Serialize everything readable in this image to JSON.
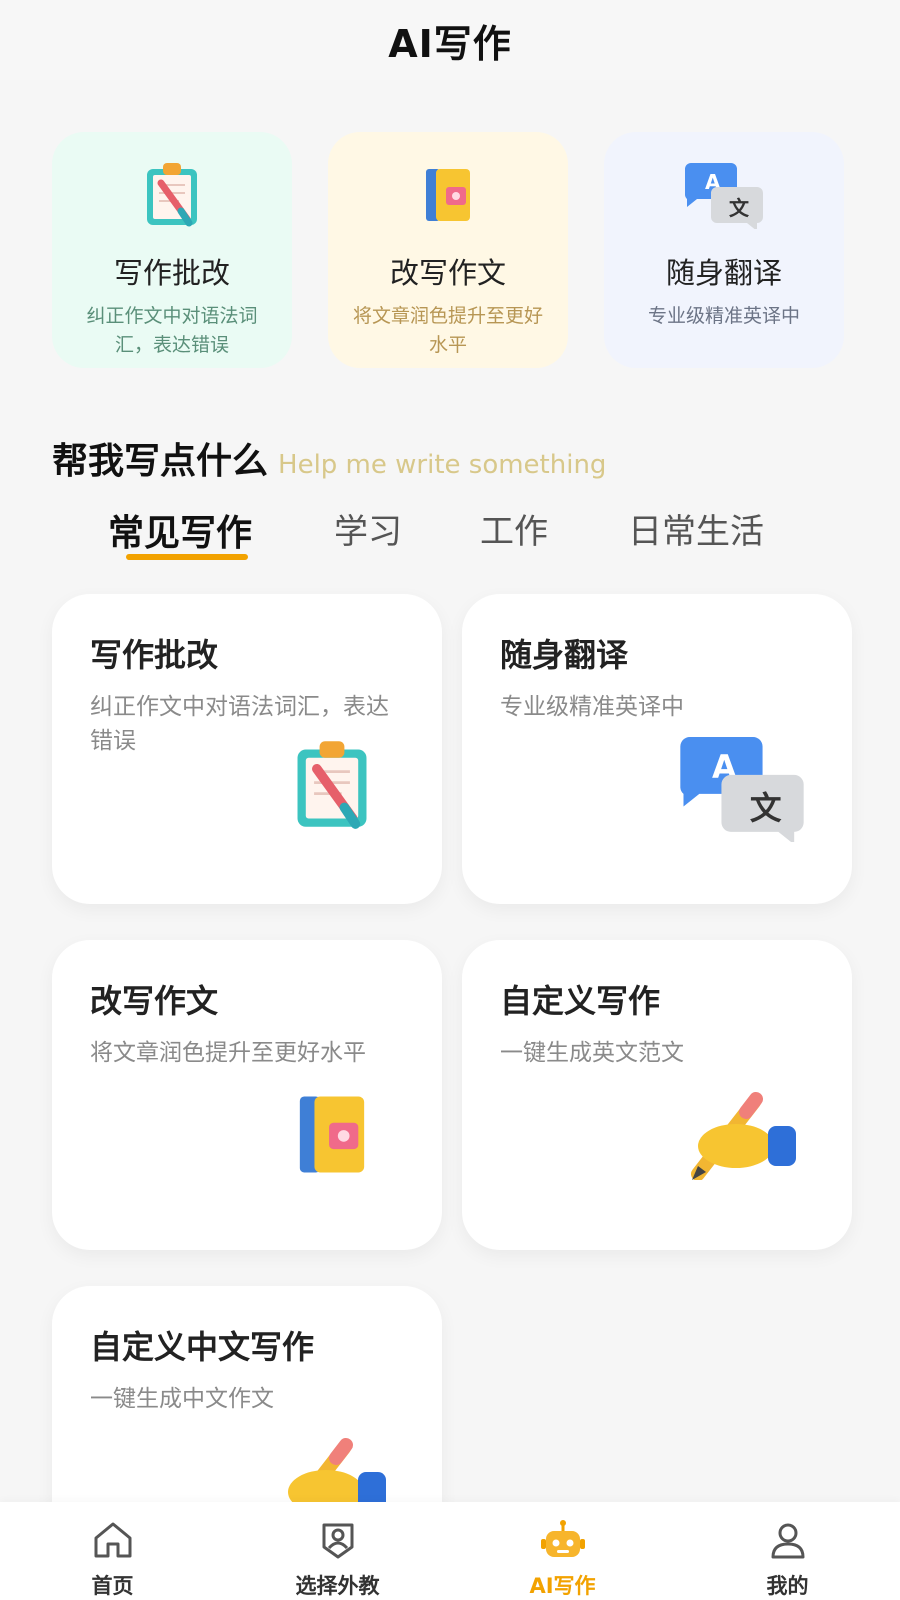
{
  "header": {
    "title": "AI写作"
  },
  "top_cards": [
    {
      "title": "写作批改",
      "subtitle": "纠正作文中对语法词汇，表达错误",
      "icon": "clipboard-pen-icon"
    },
    {
      "title": "改写作文",
      "subtitle": "将文章润色提升至更好水平",
      "icon": "book-icon"
    },
    {
      "title": "随身翻译",
      "subtitle": "专业级精准英译中",
      "icon": "translate-icon"
    }
  ],
  "section": {
    "title": "帮我写点什么",
    "subtitle": "Help me write something"
  },
  "tabs": [
    {
      "label": "常见写作",
      "active": true
    },
    {
      "label": "学习",
      "active": false
    },
    {
      "label": "工作",
      "active": false
    },
    {
      "label": "日常生活",
      "active": false
    }
  ],
  "cards": [
    {
      "title": "写作批改",
      "subtitle": "纠正作文中对语法词汇，表达错误",
      "icon": "clipboard-pen-icon"
    },
    {
      "title": "随身翻译",
      "subtitle": "专业级精准英译中",
      "icon": "translate-icon"
    },
    {
      "title": "改写作文",
      "subtitle": "将文章润色提升至更好水平",
      "icon": "book-icon"
    },
    {
      "title": "自定义写作",
      "subtitle": "一键生成英文范文",
      "icon": "hand-pencil-icon"
    },
    {
      "title": "自定义中文写作",
      "subtitle": "一键生成中文作文",
      "icon": "hand-pencil-icon"
    }
  ],
  "bottom_nav": [
    {
      "label": "首页",
      "icon": "home-icon",
      "active": false
    },
    {
      "label": "选择外教",
      "icon": "teacher-badge-icon",
      "active": false
    },
    {
      "label": "AI写作",
      "icon": "robot-icon",
      "active": true
    },
    {
      "label": "我的",
      "icon": "user-icon",
      "active": false
    }
  ],
  "colors": {
    "accent": "#f2a200",
    "background": "#f6f6f6"
  }
}
